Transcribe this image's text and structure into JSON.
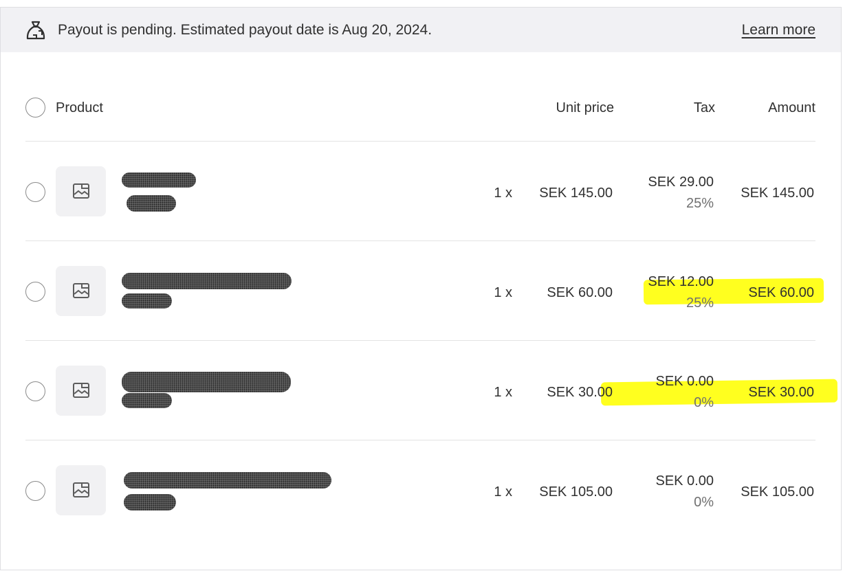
{
  "banner": {
    "icon": "money-bag-icon",
    "text": "Payout is pending. Estimated payout date is Aug 20, 2024.",
    "link": "Learn more"
  },
  "table": {
    "headers": {
      "product": "Product",
      "unit_price": "Unit price",
      "tax": "Tax",
      "amount": "Amount"
    },
    "rows": [
      {
        "qty": "1 x",
        "unit_price": "SEK 145.00",
        "tax": "SEK 29.00",
        "tax_rate": "25%",
        "amount": "SEK 145.00"
      },
      {
        "qty": "1 x",
        "unit_price": "SEK 60.00",
        "tax": "SEK 12.00",
        "tax_rate": "25%",
        "amount": "SEK 60.00"
      },
      {
        "qty": "1 x",
        "unit_price": "SEK 30.00",
        "tax": "SEK 0.00",
        "tax_rate": "0%",
        "amount": "SEK 30.00"
      },
      {
        "qty": "1 x",
        "unit_price": "SEK 105.00",
        "tax": "SEK 0.00",
        "tax_rate": "0%",
        "amount": "SEK 105.00"
      }
    ]
  },
  "colors": {
    "banner_bg": "#f1f1f4",
    "highlight": "#ffff00",
    "divider": "#e3e3e3"
  }
}
